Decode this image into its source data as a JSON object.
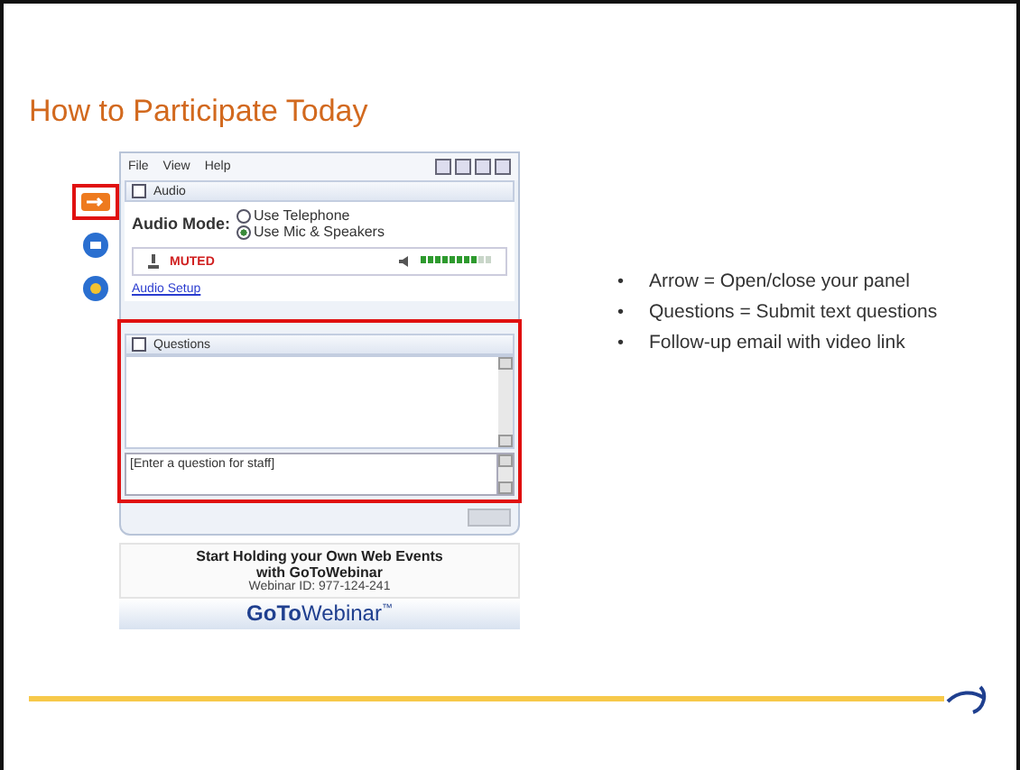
{
  "slide": {
    "title": "How to Participate Today"
  },
  "panel": {
    "menu": [
      "File",
      "View",
      "Help"
    ],
    "side_icons": [
      {
        "kind": "arrow",
        "highlighted": true
      },
      {
        "kind": "screen",
        "highlighted": false
      },
      {
        "kind": "hand",
        "highlighted": false
      }
    ],
    "audio": {
      "header": "Audio",
      "mode_label": "Audio Mode:",
      "options": [
        {
          "label": "Use Telephone",
          "selected": false
        },
        {
          "label": "Use Mic & Speakers",
          "selected": true
        }
      ],
      "mic_status": "MUTED",
      "level": 0.8,
      "setup_link": "Audio Setup"
    },
    "questions": {
      "header": "Questions",
      "highlighted": true,
      "placeholder": "[Enter a question for staff]"
    },
    "promo": {
      "headline": "Start Holding your Own Web Events with GoToWebinar",
      "webinar_id": "Webinar ID: 977-124-241"
    },
    "brand": {
      "bold": "GoTo",
      "light": "Webinar",
      "mark": "™"
    }
  },
  "bullets": [
    {
      "marker": "•",
      "text": "Arrow = Open/close your panel"
    },
    {
      "marker": "•",
      "text": "Questions = Submit text questions"
    },
    {
      "marker": "•",
      "text": "Follow-up email with video link"
    }
  ]
}
